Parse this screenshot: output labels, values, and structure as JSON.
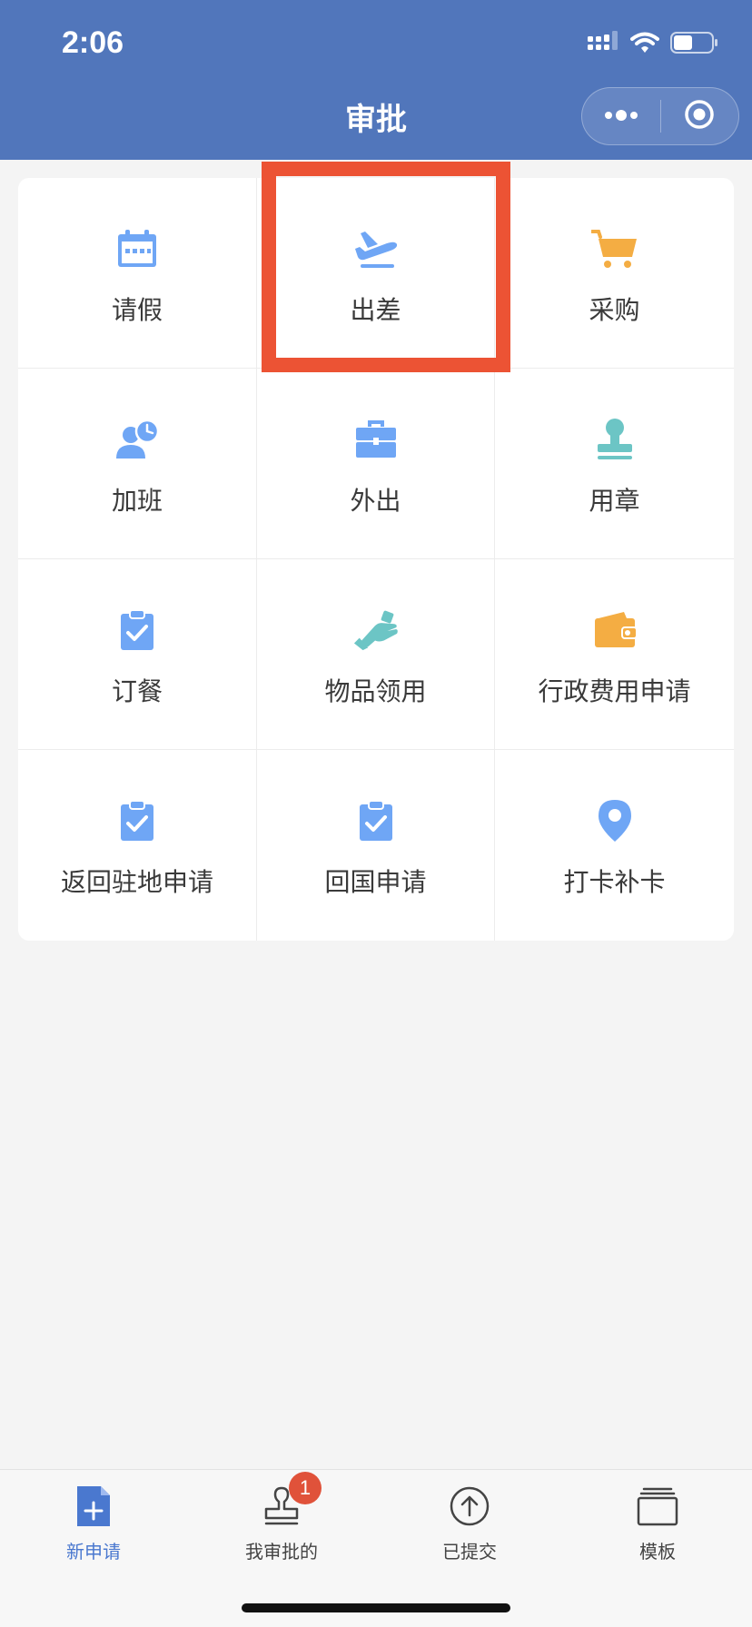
{
  "status_bar": {
    "time": "2:06"
  },
  "header": {
    "title": "审批"
  },
  "colors": {
    "header_bg": "#5176bb",
    "blue_icon": "#6fa6f5",
    "orange_icon": "#f4ad43",
    "teal_icon": "#6cc5c5",
    "highlight": "#ec5334",
    "badge": "#e0523a"
  },
  "grid": {
    "items": [
      {
        "label": "请假",
        "icon": "calendar-icon"
      },
      {
        "label": "出差",
        "icon": "airplane-icon"
      },
      {
        "label": "采购",
        "icon": "shopping-cart-icon"
      },
      {
        "label": "加班",
        "icon": "person-clock-icon"
      },
      {
        "label": "外出",
        "icon": "briefcase-icon"
      },
      {
        "label": "用章",
        "icon": "stamp-icon"
      },
      {
        "label": "订餐",
        "icon": "clipboard-check-icon"
      },
      {
        "label": "物品领用",
        "icon": "hand-receive-icon"
      },
      {
        "label": "行政费用申请",
        "icon": "wallet-icon"
      },
      {
        "label": "返回驻地申请",
        "icon": "clipboard-check-icon"
      },
      {
        "label": "回国申请",
        "icon": "clipboard-check-icon"
      },
      {
        "label": "打卡补卡",
        "icon": "location-pin-icon"
      }
    ]
  },
  "tabbar": {
    "tabs": [
      {
        "label": "新申请",
        "icon": "new-document-icon",
        "active": true
      },
      {
        "label": "我审批的",
        "icon": "stamp-outline-icon",
        "badge": "1"
      },
      {
        "label": "已提交",
        "icon": "upload-circle-icon"
      },
      {
        "label": "模板",
        "icon": "template-stack-icon"
      }
    ]
  }
}
